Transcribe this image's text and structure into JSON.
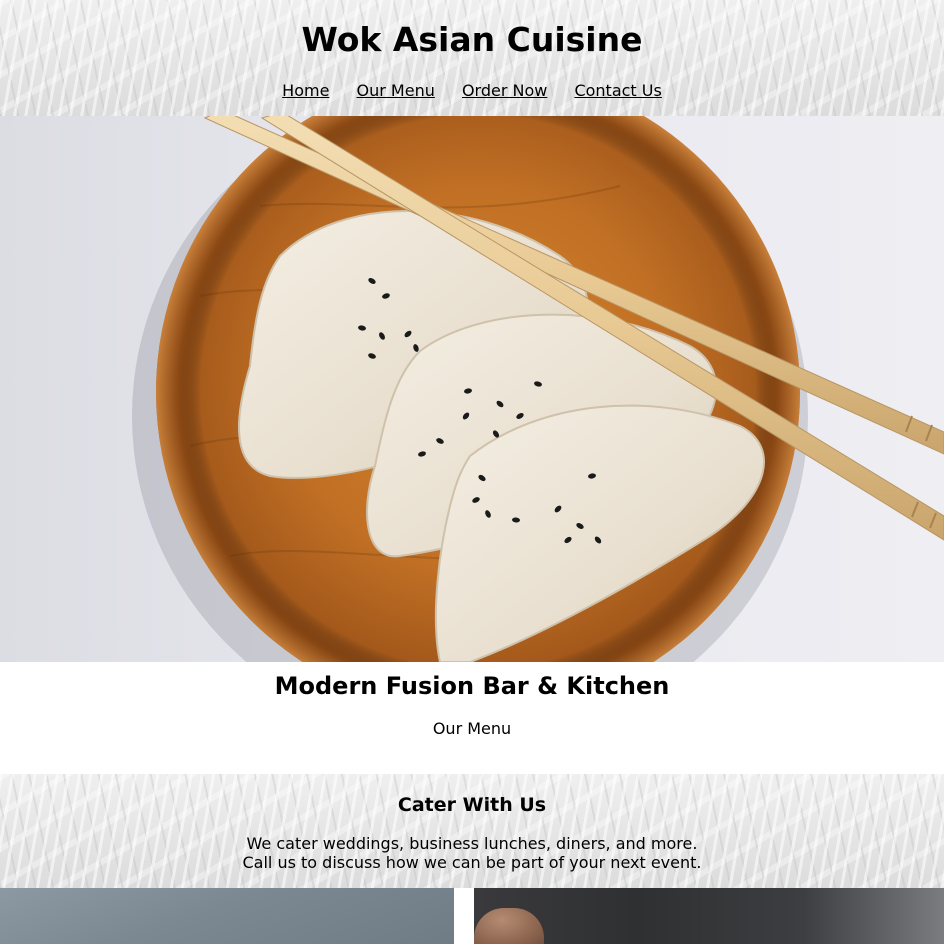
{
  "header": {
    "title": "Wok Asian Cuisine",
    "nav": [
      {
        "label": "Home"
      },
      {
        "label": "Our Menu"
      },
      {
        "label": "Order Now"
      },
      {
        "label": "Contact Us"
      }
    ]
  },
  "hero": {
    "tagline": "Modern Fusion Bar & Kitchen",
    "menu_link": "Our Menu"
  },
  "cater": {
    "title": "Cater With Us",
    "line1": "We cater weddings, business lunches, diners, and more.",
    "line2": "Call us to discuss how we can be part of your next event."
  },
  "colors": {
    "text": "#000000",
    "section_bg": "#ffffff",
    "texture_base": "#e9e9e9"
  }
}
